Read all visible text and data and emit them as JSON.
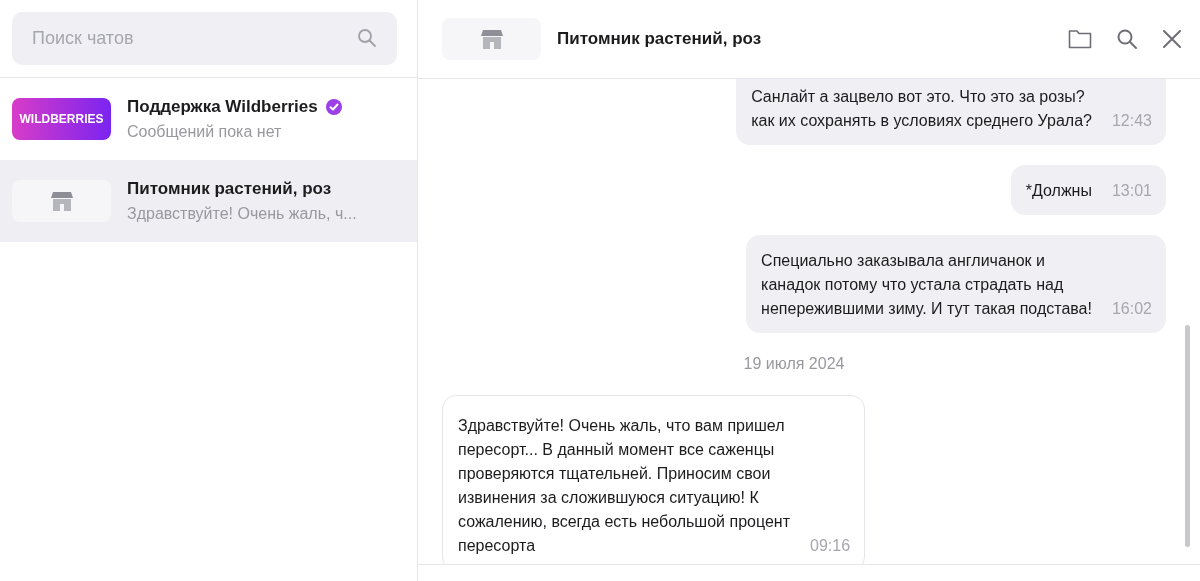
{
  "sidebar": {
    "search": {
      "placeholder": "Поиск чатов"
    },
    "chats": [
      {
        "avatar": {
          "kind": "logo",
          "text": "WILDBERRIES"
        },
        "name": "Поддержка Wildberries",
        "verified": true,
        "preview": "Сообщений пока нет",
        "selected": false
      },
      {
        "avatar": {
          "kind": "store"
        },
        "name": "Питомник растений, роз",
        "verified": false,
        "preview": "Здравствуйте! Очень жаль, ч...",
        "selected": true
      }
    ]
  },
  "chat": {
    "header": {
      "title": "Питомник растений, роз"
    },
    "items": [
      {
        "kind": "outgoing",
        "lines": [
          "Санлайт а зацвело вот это. Что это за розы?",
          "как их сохранять в условиях среднего Урала?"
        ],
        "time": "12:43",
        "cut_top": true
      },
      {
        "kind": "outgoing",
        "lines": [
          "*Должны"
        ],
        "time": "13:01"
      },
      {
        "kind": "outgoing",
        "lines": [
          "Специально заказывала англичанок и",
          "канадок потому что устала страдать над",
          "непережившими зиму. И тут такая подстава!"
        ],
        "time": "16:02"
      },
      {
        "kind": "date",
        "text": "19 июля 2024"
      },
      {
        "kind": "incoming",
        "lines": [
          "Здравствуйте! Очень жаль, что вам пришел",
          "пересорт... В данный момент все саженцы",
          "проверяются тщательней. Приносим свои",
          "извинения за сложившуюся ситуацию! К",
          "сожалению, всегда есть небольшой процент",
          "пересорта"
        ],
        "time": "09:16"
      }
    ]
  }
}
